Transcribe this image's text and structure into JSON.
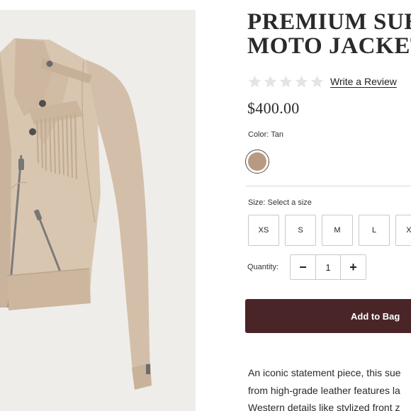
{
  "product": {
    "title_lines": [
      "PREMIUM SUE",
      "MOTO JACKET"
    ],
    "rating": {
      "filled": 0,
      "max": 5
    },
    "review_link": "Write a Review",
    "price": "$400.00",
    "color": {
      "label": "Color: Tan",
      "swatch_hex": "#b89a83"
    },
    "size": {
      "label": "Size: Select a size",
      "options": [
        "XS",
        "S",
        "M",
        "L",
        "XL"
      ]
    },
    "quantity": {
      "label": "Quantity:",
      "value": "1",
      "minus": "−",
      "plus": "+"
    },
    "add_to_bag": "Add to Bag",
    "description_lines": [
      "An iconic statement piece, this sue",
      "from high-grade leather features la",
      "Western details like stylized front z"
    ]
  },
  "colors": {
    "accent": "#4a2527",
    "star_empty": "#e4e4e4",
    "image_bg": "#efedea"
  }
}
